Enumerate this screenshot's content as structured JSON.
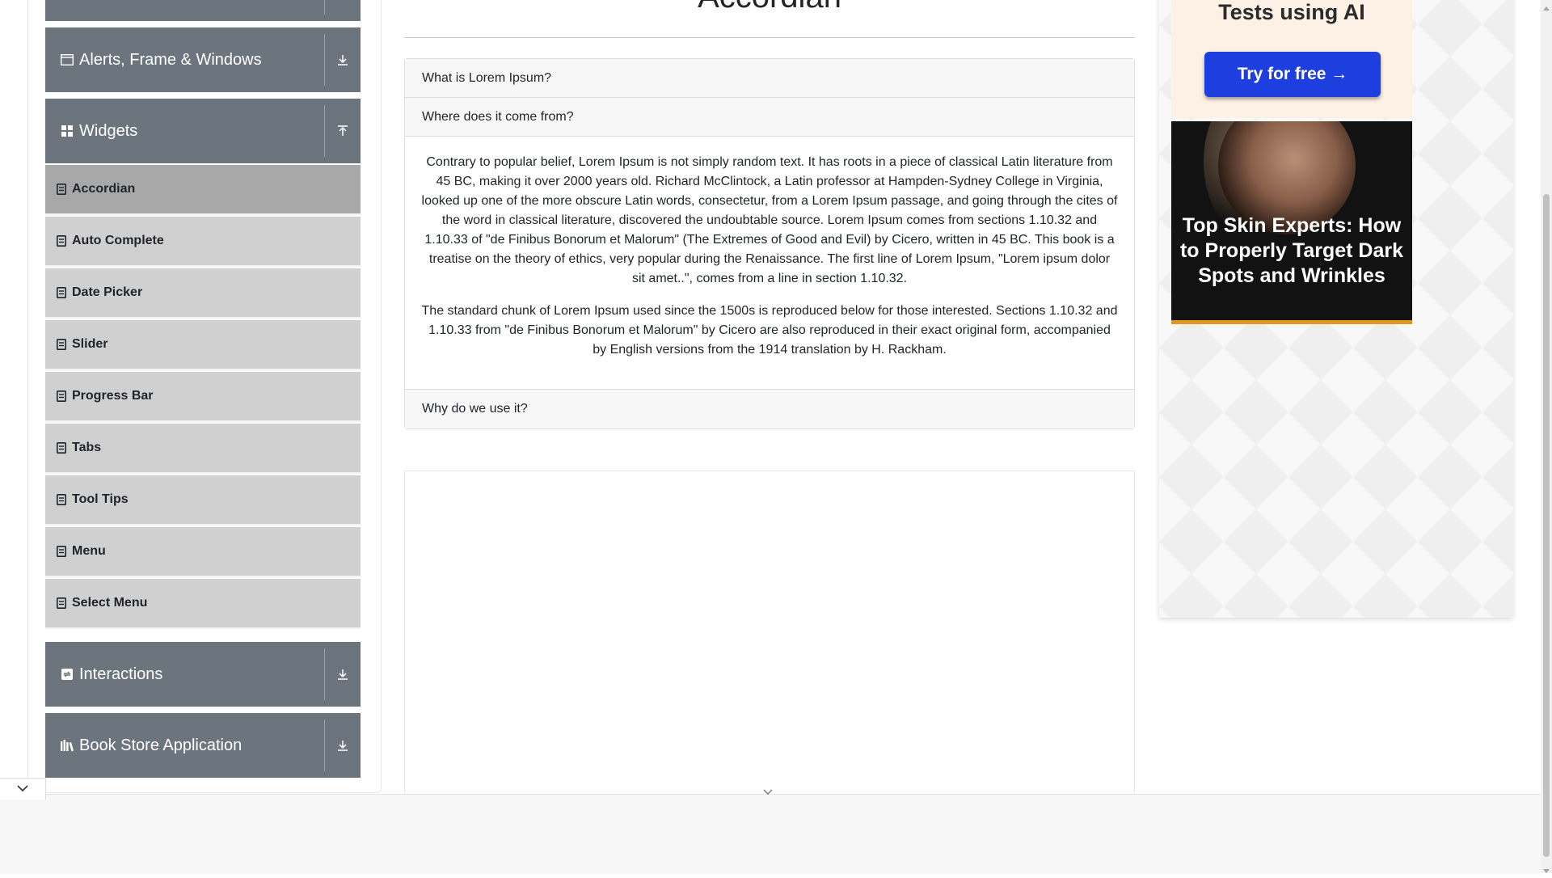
{
  "sidebar": {
    "groups": {
      "alerts": {
        "label": "Alerts, Frame & Windows",
        "icon": "window-icon",
        "expanded": false
      },
      "widgets": {
        "label": "Widgets",
        "icon": "grid-icon",
        "expanded": true
      },
      "interactions": {
        "label": "Interactions",
        "icon": "interactions-icon",
        "expanded": false
      },
      "bookstore": {
        "label": "Book Store Application",
        "icon": "books-icon",
        "expanded": false
      }
    },
    "widget_items": [
      {
        "label": "Accordian",
        "active": true
      },
      {
        "label": "Auto Complete",
        "active": false
      },
      {
        "label": "Date Picker",
        "active": false
      },
      {
        "label": "Slider",
        "active": false
      },
      {
        "label": "Progress Bar",
        "active": false
      },
      {
        "label": "Tabs",
        "active": false
      },
      {
        "label": "Tool Tips",
        "active": false
      },
      {
        "label": "Menu",
        "active": false
      },
      {
        "label": "Select Menu",
        "active": false
      }
    ]
  },
  "main": {
    "title": "Accordian",
    "sections": [
      {
        "heading": "What is Lorem Ipsum?",
        "expanded": false
      },
      {
        "heading": "Where does it come from?",
        "expanded": true,
        "paragraphs": [
          "Contrary to popular belief, Lorem Ipsum is not simply random text. It has roots in a piece of classical Latin literature from 45 BC, making it over 2000 years old. Richard McClintock, a Latin professor at Hampden-Sydney College in Virginia, looked up one of the more obscure Latin words, consectetur, from a Lorem Ipsum passage, and going through the cites of the word in classical literature, discovered the undoubtable source. Lorem Ipsum comes from sections 1.10.32 and 1.10.33 of \"de Finibus Bonorum et Malorum\" (The Extremes of Good and Evil) by Cicero, written in 45 BC. This book is a treatise on the theory of ethics, very popular during the Renaissance. The first line of Lorem Ipsum, \"Lorem ipsum dolor sit amet..\", comes from a line in section 1.10.32.",
          "The standard chunk of Lorem Ipsum used since the 1500s is reproduced below for those interested. Sections 1.10.32 and 1.10.33 from \"de Finibus Bonorum et Malorum\" by Cicero are also reproduced in their exact original form, accompanied by English versions from the 1914 translation by H. Rackham."
        ]
      },
      {
        "heading": "Why do we use it?",
        "expanded": false
      }
    ]
  },
  "ads": {
    "promo_text": "Tests using AI",
    "promo_button": "Try for free →",
    "promo_button_color": "#1d3fe0",
    "skin_headline": "Top Skin Experts: How to Properly Target Dark Spots and Wrinkles"
  },
  "colors": {
    "group_bg": "#6c757d",
    "item_bg": "#d0d0d0",
    "active_item_bg": "#a8a8a8"
  }
}
